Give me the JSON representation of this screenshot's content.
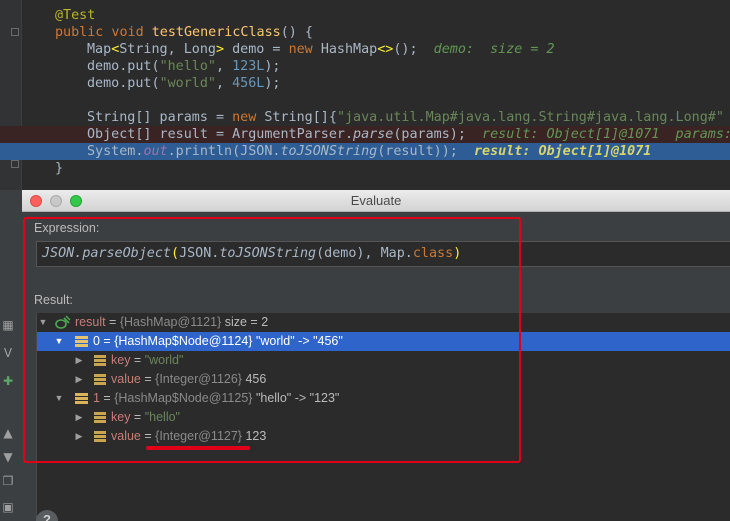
{
  "editor": {
    "lines": [
      {
        "id": "l1",
        "parts": [
          [
            "ann",
            "@Test"
          ]
        ]
      },
      {
        "id": "l2",
        "parts": [
          [
            "kw",
            "public void "
          ],
          [
            "fn",
            "testGenericClass"
          ],
          [
            "",
            "() {"
          ]
        ]
      },
      {
        "id": "l3",
        "parts": [
          [
            "",
            "Map"
          ],
          [
            "paren",
            "<"
          ],
          [
            "",
            "String, Long"
          ],
          [
            "paren",
            ">"
          ],
          [
            "",
            " demo = "
          ],
          [
            "kw",
            "new "
          ],
          [
            "",
            "HashMap"
          ],
          [
            "paren",
            "<>"
          ],
          [
            "",
            "();"
          ],
          [
            "hint",
            "  demo:  size = 2"
          ]
        ]
      },
      {
        "id": "l4",
        "parts": [
          [
            "",
            "demo.put("
          ],
          [
            "str",
            "\"hello\""
          ],
          [
            "",
            ", "
          ],
          [
            "num",
            "123L"
          ],
          [
            "",
            ");"
          ]
        ]
      },
      {
        "id": "l5",
        "parts": [
          [
            "",
            "demo.put("
          ],
          [
            "str",
            "\"world\""
          ],
          [
            "",
            ", "
          ],
          [
            "num",
            "456L"
          ],
          [
            "",
            ");"
          ]
        ]
      },
      {
        "id": "l6",
        "parts": [
          [
            "",
            ""
          ]
        ]
      },
      {
        "id": "l7",
        "parts": [
          [
            "",
            "String[] params = "
          ],
          [
            "kw",
            "new "
          ],
          [
            "",
            "String[]{"
          ],
          [
            "str",
            "\"java.util.Map#java.lang.String#java.lang.Long#\""
          ],
          [
            "",
            " +"
          ]
        ]
      },
      {
        "id": "l8",
        "parts": [
          [
            "",
            "Object[] result = ArgumentParser."
          ],
          [
            "it",
            "parse"
          ],
          [
            "",
            "(params);"
          ],
          [
            "kw",
            " "
          ],
          [
            "hint",
            " result: Object[1]@1071  params: "
          ]
        ]
      },
      {
        "id": "l9",
        "parts": [
          [
            "",
            "System."
          ],
          [
            "fld",
            "out"
          ],
          [
            "",
            ".println(JSON."
          ],
          [
            "it",
            "toJSONString"
          ],
          [
            "",
            "(result));"
          ],
          [
            "hint",
            "  result: Object[1]@1071"
          ]
        ]
      },
      {
        "id": "l10",
        "parts": [
          [
            "",
            "}"
          ]
        ]
      }
    ]
  },
  "dialog": {
    "title": "Evaluate",
    "expression_label": "Expression:",
    "expression_parts": [
      [
        "it",
        "JSON."
      ],
      [
        "it",
        "parseObject"
      ],
      [
        "paren",
        "("
      ],
      [
        "",
        "JSON."
      ],
      [
        "it",
        "toJSONString"
      ],
      [
        "",
        "(demo), Map."
      ],
      [
        "kw",
        "class"
      ],
      [
        "paren",
        ")"
      ]
    ],
    "result_label": "Result:",
    "tree": {
      "root": {
        "name": "result",
        "eq": " = ",
        "type": "{HashMap@1121}",
        "extra": "  size = 2"
      },
      "entry0": {
        "name": "0",
        "eq": " = ",
        "type": "{HashMap$Node@1124}",
        "extra": " \"world\" -> \"456\""
      },
      "entry0_key": {
        "name": "key",
        "eq": " = ",
        "value": "\"world\""
      },
      "entry0_value": {
        "name": "value",
        "eq": " = ",
        "type": "{Integer@1126}",
        "extra": " 456"
      },
      "entry1": {
        "name": "1",
        "eq": " = ",
        "type": "{HashMap$Node@1125}",
        "extra": " \"hello\" -> \"123\""
      },
      "entry1_key": {
        "name": "key",
        "eq": " = ",
        "value": "\"hello\""
      },
      "entry1_value": {
        "name": "value",
        "eq": " = ",
        "type": "{Integer@1127}",
        "extra": " 123"
      }
    }
  },
  "toolstrip": {
    "vars_tab": "V",
    "help": "?"
  },
  "colors": {
    "annotation": "#e0001a",
    "selection": "#2f65ca",
    "exec_line": "#2d5d94"
  }
}
